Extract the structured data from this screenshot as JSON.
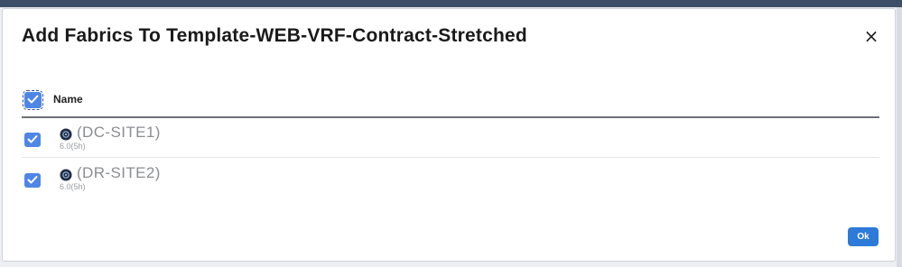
{
  "dialog": {
    "title": "Add Fabrics To Template-WEB-VRF-Contract-Stretched",
    "close_label": "×",
    "ok_label": "Ok"
  },
  "table": {
    "header": {
      "label": "Name",
      "checked": true
    },
    "rows": [
      {
        "name": "(DC-SITE1)",
        "version": "6.0(5h)",
        "checked": true,
        "icon": "fabric-site-icon"
      },
      {
        "name": "(DR-SITE2)",
        "version": "6.0(5h)",
        "checked": true,
        "icon": "fabric-site-icon"
      }
    ]
  },
  "colors": {
    "accent": "#2d7ad8",
    "checkbox": "#4f86e6",
    "backdrop": "#3d4e68"
  }
}
